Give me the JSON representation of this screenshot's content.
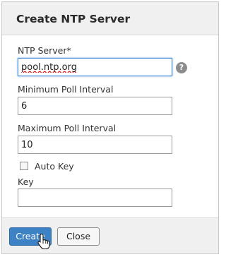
{
  "dialog": {
    "title": "Create NTP Server"
  },
  "fields": {
    "ntp_server": {
      "label": "NTP Server*",
      "value": "pool.ntp.org"
    },
    "min_poll": {
      "label": "Minimum Poll Interval",
      "value": "6"
    },
    "max_poll": {
      "label": "Maximum Poll Interval",
      "value": "10"
    },
    "auto_key": {
      "label": "Auto Key",
      "checked": false
    },
    "key": {
      "label": "Key",
      "value": ""
    }
  },
  "help_icon": {
    "glyph": "?",
    "icon": "question-mark-icon"
  },
  "buttons": {
    "create": "Create",
    "close": "Close"
  },
  "colors": {
    "primary_button": "#3d82c4",
    "focus_border": "#4a90d9"
  }
}
